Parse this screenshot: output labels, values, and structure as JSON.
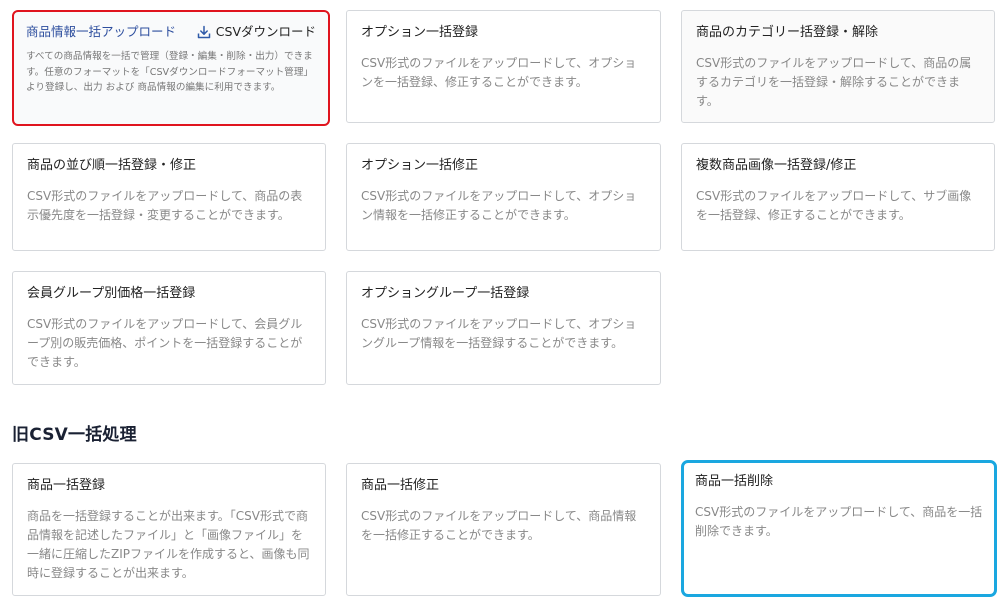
{
  "cards": [
    {
      "title": "商品情報一括アップロード",
      "action": "CSVダウンロード",
      "desc": "すべての商品情報を一括で管理（登録・編集・削除・出力）できます。任意のフォーマットを「CSVダウンロードフォーマット管理」より登録し、出力 および 商品情報の編集に利用できます。"
    },
    {
      "title": "オプション一括登録",
      "desc": "CSV形式のファイルをアップロードして、オプションを一括登録、修正することができます。"
    },
    {
      "title": "商品のカテゴリー括登録・解除",
      "desc": "CSV形式のファイルをアップロードして、商品の属するカテゴリを一括登録・解除することができます。"
    },
    {
      "title": "商品の並び順一括登録・修正",
      "desc": "CSV形式のファイルをアップロードして、商品の表示優先度を一括登録・変更することができます。"
    },
    {
      "title": "オプション一括修正",
      "desc": "CSV形式のファイルをアップロードして、オプション情報を一括修正することができます。"
    },
    {
      "title": "複数商品画像一括登録/修正",
      "desc": "CSV形式のファイルをアップロードして、サブ画像を一括登録、修正することができます。"
    },
    {
      "title": "会員グループ別価格一括登録",
      "desc": "CSV形式のファイルをアップロードして、会員グループ別の販売価格、ポイントを一括登録することができます。"
    },
    {
      "title": "オプショングループ一括登録",
      "desc": "CSV形式のファイルをアップロードして、オプショングループ情報を一括登録することができます。"
    }
  ],
  "legacy": {
    "section_title": "旧CSV一括処理",
    "cards": [
      {
        "title": "商品一括登録",
        "desc": "商品を一括登録することが出来ます。「CSV形式で商品情報を記述したファイル」と「画像ファイル」を一緒に圧縮したZIPファイルを作成すると、画像も同時に登録することが出来ます。"
      },
      {
        "title": "商品一括修正",
        "desc": "CSV形式のファイルをアップロードして、商品情報を一括修正することができます。"
      },
      {
        "title": "商品一括削除",
        "desc": "CSV形式のファイルをアップロードして、商品を一括削除できます。"
      }
    ]
  },
  "colors": {
    "highlight_red": "#e0141e",
    "highlight_blue": "#1aa7e0",
    "link_blue": "#2d4e9e",
    "download_icon": "#2f5aa8"
  },
  "icons": {
    "download": "download-icon"
  }
}
